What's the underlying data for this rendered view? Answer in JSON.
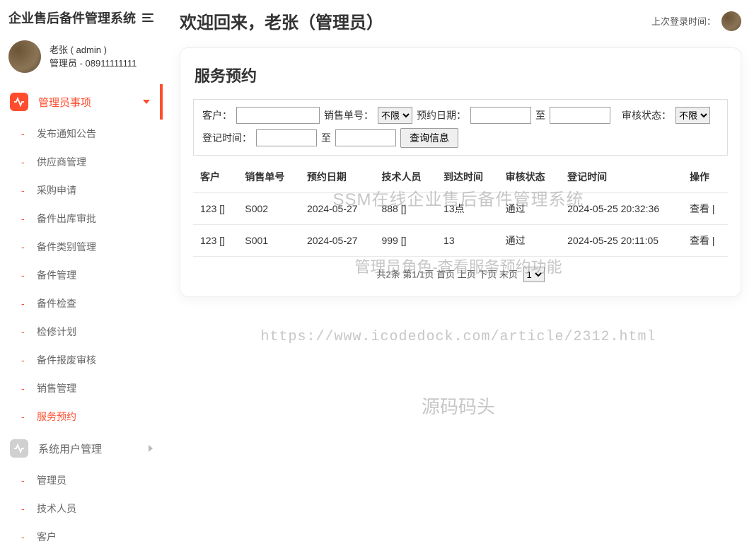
{
  "brand": "企业售后备件管理系统",
  "user": {
    "name": "老张 ( admin )",
    "role_line": "管理员 - 08911111111"
  },
  "topbar": {
    "welcome": "欢迎回来，老张（管理员）",
    "login_time_label": "上次登录时间："
  },
  "menu": {
    "admin_header": "管理员事项",
    "items": [
      "发布通知公告",
      "供应商管理",
      "采购申请",
      "备件出库审批",
      "备件类别管理",
      "备件管理",
      "备件检查",
      "检修计划",
      "备件报废审核",
      "销售管理",
      "服务预约"
    ],
    "active_index": 10,
    "sysuser_header": "系统用户管理",
    "sysuser_items": [
      "管理员",
      "技术人员",
      "客户"
    ]
  },
  "card": {
    "title": "服务预约"
  },
  "filters": {
    "customer_label": "客户：",
    "sale_no_label": "销售单号：",
    "booking_date_label": "预约日期：",
    "to_label": "至",
    "audit_label": "审核状态：",
    "reg_time_label": "登记时间：",
    "query_btn": "查询信息",
    "unlimited_option": "不限"
  },
  "table": {
    "headers": [
      "客户",
      "销售单号",
      "预约日期",
      "技术人员",
      "到达时间",
      "审核状态",
      "登记时间",
      "操作"
    ],
    "rows": [
      {
        "customer": "123 []",
        "sale_no": "S002",
        "date": "2024-05-27",
        "tech": "888 []",
        "arrive": "13点",
        "audit": "通过",
        "regtime": "2024-05-25 20:32:36",
        "action": "查看 |"
      },
      {
        "customer": "123 []",
        "sale_no": "S001",
        "date": "2024-05-27",
        "tech": "999 []",
        "arrive": "13",
        "audit": "通过",
        "regtime": "2024-05-25 20:11:05",
        "action": "查看 |"
      }
    ]
  },
  "pager": {
    "summary": "共2条  第1/1页  首页  上页  下页  末页",
    "per_option": "1"
  },
  "watermarks": {
    "w1": "SSM在线企业售后备件管理系统",
    "w2": "管理员角色-查看服务预约功能",
    "w3": "https://www.icodedock.com/article/2312.html",
    "w4": "源码码头"
  }
}
